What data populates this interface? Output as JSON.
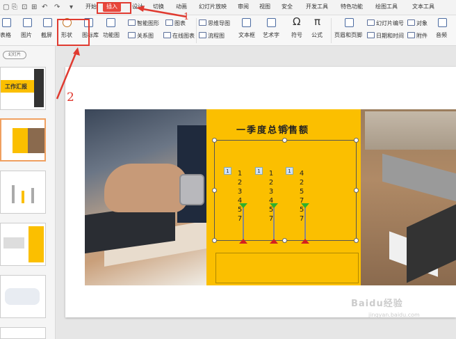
{
  "quick_access": [
    "▢",
    "⎘",
    "⊡",
    "⊞",
    "↶",
    "↷",
    "▾"
  ],
  "tabs": [
    "开始",
    "插入",
    "设计",
    "切换",
    "动画",
    "幻灯片放映",
    "审阅",
    "视图",
    "安全",
    "开发工具",
    "特色功能",
    "绘图工具",
    "文本工具"
  ],
  "ribbon": {
    "table": "表格",
    "picture": "图片",
    "screenshot": "截屏",
    "shapes": "形状",
    "icon_lib": "图标库",
    "func_chart": "功能图",
    "smart_graphic": "智能图形",
    "chart": "图表",
    "relation": "关系图",
    "online_chart": "在线图表",
    "mind_map": "思维导图",
    "flowchart": "流程图",
    "textbox": "文本框",
    "art_text": "艺术字",
    "symbol": "符号",
    "formula": "公式",
    "header_footer": "页眉和页脚",
    "slide_number": "幻灯片编号",
    "date_time": "日期和时间",
    "object": "对象",
    "attachment": "附件",
    "audio": "音频"
  },
  "left_panel": {
    "add_slide": "幻灯片",
    "thumb1_title": "工作汇报"
  },
  "slide": {
    "title": "一季度总销售额",
    "columns": [
      {
        "badge": "1",
        "values": [
          "1",
          "2",
          "3",
          "4",
          "5",
          "7"
        ]
      },
      {
        "badge": "1",
        "values": [
          "1",
          "2",
          "3",
          "4",
          "5",
          "7"
        ]
      },
      {
        "badge": "1",
        "values": [
          "4",
          "2",
          "5",
          "7",
          "5",
          "7"
        ]
      }
    ]
  },
  "annotations": {
    "one": "1",
    "two": "2"
  },
  "watermark": {
    "main": "Baidu经验",
    "sub": "jingyan.baidu.com"
  },
  "colors": {
    "accent": "#e8473c",
    "slide_yellow": "#fbbf00",
    "annotation_red": "#e03a30"
  }
}
